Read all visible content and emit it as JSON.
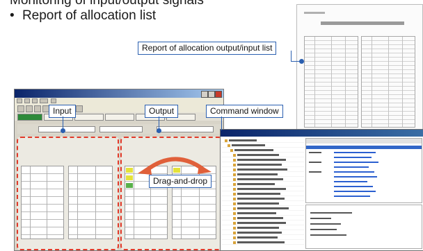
{
  "header": {
    "line1_bullet": "",
    "line1": "Monitoring of input/output signals",
    "line2_bullet": "•",
    "line2": "Report of allocation list"
  },
  "callouts": {
    "report": "Report of allocation output/input list",
    "input": "Input",
    "output": "Output",
    "command": "Command window",
    "drag": "Drag-and-drop"
  },
  "colors": {
    "callout_border": "#2a5fb0",
    "panel_dash": "#e23a2a",
    "arrow": "#e0603a",
    "title_bar": "#0a246a"
  },
  "icons": {
    "arrow": "curved-double-arrow"
  }
}
